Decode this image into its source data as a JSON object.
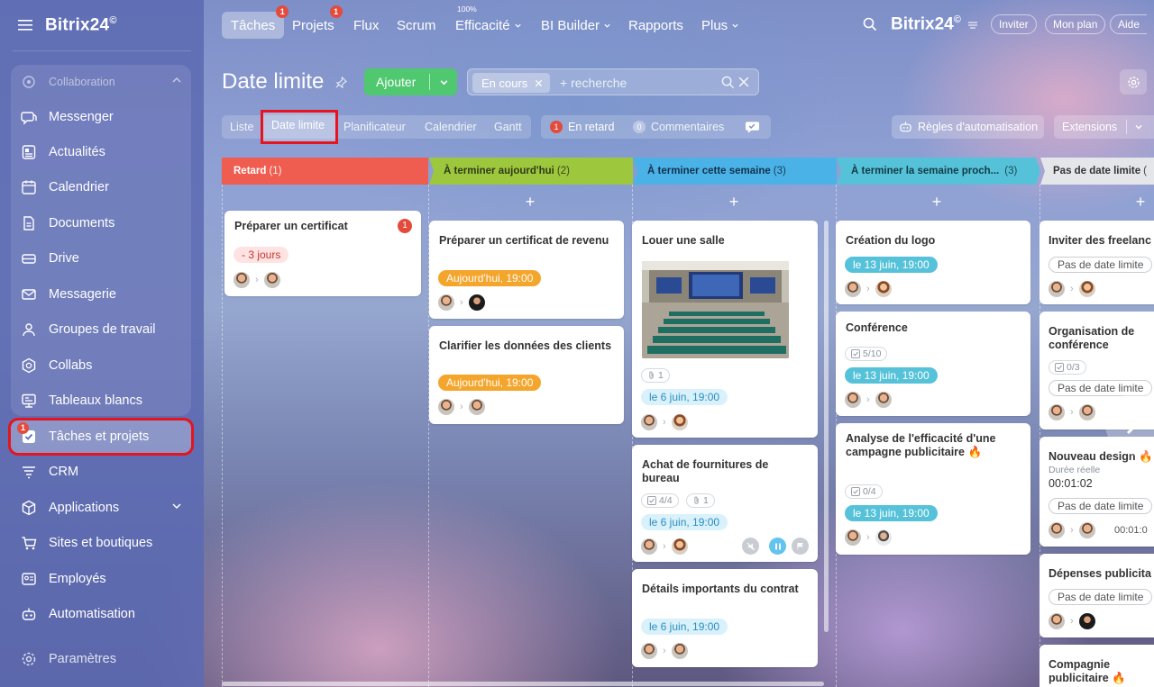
{
  "app": {
    "brand": "Bitrix24",
    "brand_mark": "©"
  },
  "sidebar": {
    "group_label": "Collaboration",
    "items": [
      {
        "label": "Messenger",
        "icon": "chat-icon"
      },
      {
        "label": "Actualités",
        "icon": "news-icon"
      },
      {
        "label": "Calendrier",
        "icon": "calendar-icon"
      },
      {
        "label": "Documents",
        "icon": "document-icon"
      },
      {
        "label": "Drive",
        "icon": "drive-icon"
      },
      {
        "label": "Messagerie",
        "icon": "mail-icon"
      },
      {
        "label": "Groupes de travail",
        "icon": "group-icon"
      },
      {
        "label": "Collabs",
        "icon": "hexagon-icon"
      },
      {
        "label": "Tableaux blancs",
        "icon": "whiteboard-icon"
      },
      {
        "label": "Tâches et projets",
        "icon": "tasks-icon",
        "badge": "1"
      },
      {
        "label": "CRM",
        "icon": "crm-icon"
      },
      {
        "label": "Applications",
        "icon": "applications-icon"
      },
      {
        "label": "Sites et boutiques",
        "icon": "cart-icon"
      },
      {
        "label": "Employés",
        "icon": "employee-icon"
      },
      {
        "label": "Automatisation",
        "icon": "robot-icon"
      },
      {
        "label": "Paramètres",
        "icon": "gear-icon"
      }
    ]
  },
  "topnav": {
    "tasks": "Tâches",
    "tasks_badge": "1",
    "projects": "Projets",
    "projects_badge": "1",
    "flux": "Flux",
    "scrum": "Scrum",
    "efficiency": "Efficacité",
    "efficiency_value": "100%",
    "bi": "BI Builder",
    "reports": "Rapports",
    "more": "Plus",
    "brand": "Bitrix24",
    "invite": "Inviter",
    "plan": "Mon plan",
    "help": "Aide"
  },
  "header": {
    "title": "Date limite",
    "add_button": "Ajouter",
    "filter_chip": "En cours",
    "search_placeholder": "+ recherche"
  },
  "views": {
    "tabs": [
      "Liste",
      "Date limite",
      "Planificateur",
      "Calendrier",
      "Gantt"
    ],
    "active": "Date limite"
  },
  "counters": {
    "overdue_count": "1",
    "overdue_label": "En retard",
    "comments_count": "0",
    "comments_label": "Commentaires"
  },
  "toolbar": {
    "automation_rules": "Règles d'automatisation",
    "extensions": "Extensions"
  },
  "columns": [
    {
      "title": "Retard",
      "count": "(1)",
      "color": "#ee5d50",
      "cards": [
        {
          "title": "Préparer un certificat",
          "badge": "1",
          "deadline": "- 3 jours",
          "deadline_style": "red"
        }
      ]
    },
    {
      "title": "À terminer aujourd'hui",
      "count": "(2)",
      "color": "#9dc73c",
      "cards": [
        {
          "title": "Préparer un certificat de revenu",
          "deadline": "Aujourd'hui, 19:00",
          "deadline_style": "orange"
        },
        {
          "title": "Clarifier les données des clients",
          "deadline": "Aujourd'hui, 19:00",
          "deadline_style": "orange"
        }
      ]
    },
    {
      "title": "À terminer cette semaine",
      "count": "(3)",
      "color": "#4bb2e8",
      "cards": [
        {
          "title": "Louer une salle",
          "files": "1",
          "deadline": "le 6 juin, 19:00",
          "deadline_style": "lightblue"
        },
        {
          "title": "Achat de fournitures de bureau",
          "checklist": "4/4",
          "files": "1",
          "deadline": "le 6 juin, 19:00",
          "deadline_style": "lightblue"
        },
        {
          "title": "Détails importants du contrat",
          "deadline": "le 6 juin, 19:00",
          "deadline_style": "lightblue"
        }
      ]
    },
    {
      "title": "À terminer la semaine proch...",
      "count": "(3)",
      "color": "#56c2d9",
      "cards": [
        {
          "title": "Création du logo",
          "deadline": "le 13 juin, 19:00",
          "deadline_style": "teal"
        },
        {
          "title": "Conférence",
          "checklist": "5/10",
          "deadline": "le 13 juin, 19:00",
          "deadline_style": "teal"
        },
        {
          "title": "Analyse de l'efficacité d'une campagne publicitaire",
          "deadline": "le 13 juin, 19:00",
          "deadline_style": "teal"
        }
      ]
    },
    {
      "title": "Pas de date limite",
      "count": "(",
      "color": "#e4e6e9",
      "cards": [
        {
          "title": "Inviter des freelanc",
          "deadline": "Pas de date limite"
        },
        {
          "title": "Organisation de conférence",
          "checklist": "0/3",
          "deadline": "Pas de date limite"
        },
        {
          "title": "Nouveau design",
          "time_label": "Durée réelle",
          "time_value": "00:01:02",
          "deadline": "Pas de date limite",
          "time_small": "00:01:0"
        },
        {
          "title": "Dépenses publicita",
          "deadline": "Pas de date limite"
        },
        {
          "title": "Compagnie publicitaire"
        }
      ]
    }
  ],
  "extra": {
    "campaign_checklist": "0/4"
  }
}
